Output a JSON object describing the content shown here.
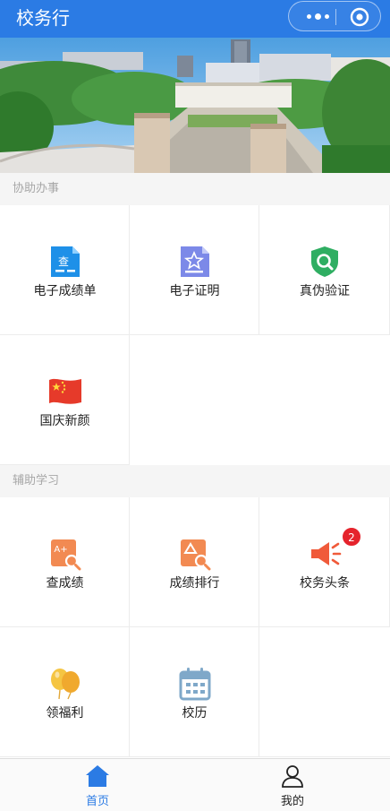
{
  "app": {
    "title": "校务行"
  },
  "colors": {
    "primary": "#2b7be4",
    "badge": "#e5232c"
  },
  "sections": [
    {
      "title": "协助办事",
      "items": [
        {
          "label": "电子成绩单",
          "icon": "transcript-document-icon"
        },
        {
          "label": "电子证明",
          "icon": "certificate-document-icon"
        },
        {
          "label": "真伪验证",
          "icon": "shield-search-icon"
        },
        {
          "label": "国庆新颜",
          "icon": "china-flag-icon"
        }
      ]
    },
    {
      "title": "辅助学习",
      "items": [
        {
          "label": "查成绩",
          "icon": "grade-search-icon"
        },
        {
          "label": "成绩排行",
          "icon": "ranking-search-icon"
        },
        {
          "label": "校务头条",
          "icon": "megaphone-icon",
          "badge": "2"
        },
        {
          "label": "领福利",
          "icon": "balloons-icon"
        },
        {
          "label": "校历",
          "icon": "calendar-icon"
        }
      ]
    }
  ],
  "tabbar": {
    "items": [
      {
        "label": "首页",
        "icon": "home-icon",
        "active": true
      },
      {
        "label": "我的",
        "icon": "person-icon",
        "active": false
      }
    ]
  }
}
